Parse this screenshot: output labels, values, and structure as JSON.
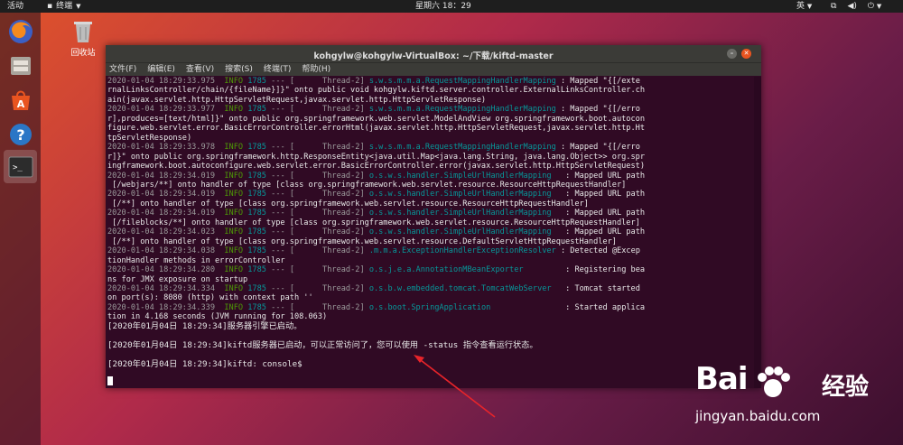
{
  "topbar": {
    "activities": "活动",
    "app_menu": "终端",
    "clock": "星期六 18：29",
    "input_method": "英"
  },
  "desktop": {
    "trash_label": "回收站"
  },
  "window": {
    "title": "kohgylw@kohgylw-VirtualBox: ~/下载/kiftd-master",
    "menus": [
      "文件(F)",
      "编辑(E)",
      "查看(V)",
      "搜索(S)",
      "终端(T)",
      "帮助(H)"
    ]
  },
  "terminal": {
    "lines": [
      {
        "kind": "log",
        "ts": "2020-01-04 18:29:33.975",
        "lvl": "INFO",
        "pid": "1785",
        "sep": "--- [",
        "thread": "      Thread-2]",
        "logger": "s.w.s.m.m.a.RequestMappingHandlerMapping",
        "msg": " : Mapped \"{[/exte"
      },
      {
        "kind": "plain",
        "text": "rnalLinksController/chain/{fileName}]}\" onto public void kohgylw.kiftd.server.controller.ExternalLinksController.ch"
      },
      {
        "kind": "plain",
        "text": "ain(javax.servlet.http.HttpServletRequest,javax.servlet.http.HttpServletResponse)"
      },
      {
        "kind": "log",
        "ts": "2020-01-04 18:29:33.977",
        "lvl": "INFO",
        "pid": "1785",
        "sep": "--- [",
        "thread": "      Thread-2]",
        "logger": "s.w.s.m.m.a.RequestMappingHandlerMapping",
        "msg": " : Mapped \"{[/erro"
      },
      {
        "kind": "plain",
        "text": "r],produces=[text/html]}\" onto public org.springframework.web.servlet.ModelAndView org.springframework.boot.autocon"
      },
      {
        "kind": "plain",
        "text": "figure.web.servlet.error.BasicErrorController.errorHtml(javax.servlet.http.HttpServletRequest,javax.servlet.http.Ht"
      },
      {
        "kind": "plain",
        "text": "tpServletResponse)"
      },
      {
        "kind": "log",
        "ts": "2020-01-04 18:29:33.978",
        "lvl": "INFO",
        "pid": "1785",
        "sep": "--- [",
        "thread": "      Thread-2]",
        "logger": "s.w.s.m.m.a.RequestMappingHandlerMapping",
        "msg": " : Mapped \"{[/erro"
      },
      {
        "kind": "plain",
        "text": "r]}\" onto public org.springframework.http.ResponseEntity<java.util.Map<java.lang.String, java.lang.Object>> org.spr"
      },
      {
        "kind": "plain",
        "text": "ingframework.boot.autoconfigure.web.servlet.error.BasicErrorController.error(javax.servlet.http.HttpServletRequest)"
      },
      {
        "kind": "log",
        "ts": "2020-01-04 18:29:34.019",
        "lvl": "INFO",
        "pid": "1785",
        "sep": "--- [",
        "thread": "      Thread-2]",
        "logger": "o.s.w.s.handler.SimpleUrlHandlerMapping  ",
        "msg": " : Mapped URL path"
      },
      {
        "kind": "plain",
        "text": " [/webjars/**] onto handler of type [class org.springframework.web.servlet.resource.ResourceHttpRequestHandler]"
      },
      {
        "kind": "log",
        "ts": "2020-01-04 18:29:34.019",
        "lvl": "INFO",
        "pid": "1785",
        "sep": "--- [",
        "thread": "      Thread-2]",
        "logger": "o.s.w.s.handler.SimpleUrlHandlerMapping  ",
        "msg": " : Mapped URL path"
      },
      {
        "kind": "plain",
        "text": " [/**] onto handler of type [class org.springframework.web.servlet.resource.ResourceHttpRequestHandler]"
      },
      {
        "kind": "log",
        "ts": "2020-01-04 18:29:34.019",
        "lvl": "INFO",
        "pid": "1785",
        "sep": "--- [",
        "thread": "      Thread-2]",
        "logger": "o.s.w.s.handler.SimpleUrlHandlerMapping  ",
        "msg": " : Mapped URL path"
      },
      {
        "kind": "plain",
        "text": " [/fileblocks/**] onto handler of type [class org.springframework.web.servlet.resource.ResourceHttpRequestHandler]"
      },
      {
        "kind": "log",
        "ts": "2020-01-04 18:29:34.023",
        "lvl": "INFO",
        "pid": "1785",
        "sep": "--- [",
        "thread": "      Thread-2]",
        "logger": "o.s.w.s.handler.SimpleUrlHandlerMapping  ",
        "msg": " : Mapped URL path"
      },
      {
        "kind": "plain",
        "text": " [/**] onto handler of type [class org.springframework.web.servlet.resource.DefaultServletHttpRequestHandler]"
      },
      {
        "kind": "log",
        "ts": "2020-01-04 18:29:34.038",
        "lvl": "INFO",
        "pid": "1785",
        "sep": "--- [",
        "thread": "      Thread-2]",
        "logger": ".m.m.a.ExceptionHandlerExceptionResolver",
        "msg": " : Detected @Excep"
      },
      {
        "kind": "plain",
        "text": "tionHandler methods in errorController"
      },
      {
        "kind": "log",
        "ts": "2020-01-04 18:29:34.280",
        "lvl": "INFO",
        "pid": "1785",
        "sep": "--- [",
        "thread": "      Thread-2]",
        "logger": "o.s.j.e.a.AnnotationMBeanExporter        ",
        "msg": " : Registering bea"
      },
      {
        "kind": "plain",
        "text": "ns for JMX exposure on startup"
      },
      {
        "kind": "log",
        "ts": "2020-01-04 18:29:34.334",
        "lvl": "INFO",
        "pid": "1785",
        "sep": "--- [",
        "thread": "      Thread-2]",
        "logger": "o.s.b.w.embedded.tomcat.TomcatWebServer  ",
        "msg": " : Tomcat started"
      },
      {
        "kind": "plain",
        "text": "on port(s): 8080 (http) with context path ''"
      },
      {
        "kind": "log",
        "ts": "2020-01-04 18:29:34.339",
        "lvl": "INFO",
        "pid": "1785",
        "sep": "--- [",
        "thread": "      Thread-2]",
        "logger": "o.s.boot.SpringApplication               ",
        "msg": " : Started applica"
      },
      {
        "kind": "plain",
        "text": "tion in 4.168 seconds (JVM running for 108.063)"
      },
      {
        "kind": "zh",
        "text": "[2020年01月04日 18:29:34]服务器引擎已启动。"
      },
      {
        "kind": "blank",
        "text": ""
      },
      {
        "kind": "zh",
        "text": "[2020年01月04日 18:29:34]kiftd服务器已启动，可以正常访问了，您可以使用 -status 指令查看运行状态。"
      },
      {
        "kind": "blank",
        "text": ""
      },
      {
        "kind": "zh",
        "text": "[2020年01月04日 18:29:34]kiftd: console$"
      }
    ]
  },
  "watermark": {
    "logo": "Bai",
    "logo_suffix": "经验",
    "url": "jingyan.baidu.com"
  },
  "colors": {
    "terminal_bg": "#300a24",
    "info_green": "#4e9a06",
    "logger_cyan": "#06989a",
    "arrow_red": "#e8242a"
  }
}
